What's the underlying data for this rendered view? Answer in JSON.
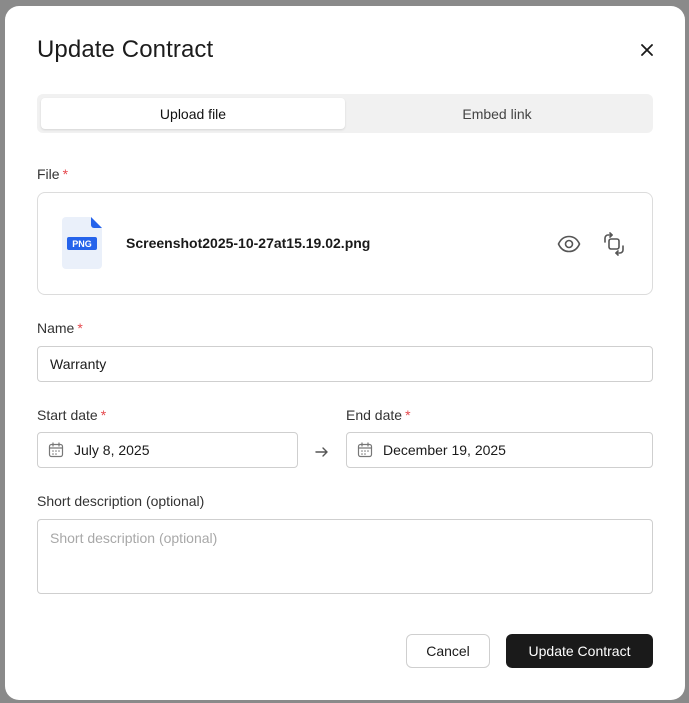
{
  "modal": {
    "title": "Update Contract"
  },
  "tabs": [
    {
      "label": "Upload file",
      "active": true
    },
    {
      "label": "Embed link",
      "active": false
    }
  ],
  "file": {
    "label": "File",
    "required_mark": "*",
    "badge": "PNG",
    "name": "Screenshot2025-10-27at15.19.02.png",
    "preview_icon": "eye-icon",
    "replace_icon": "replace-icon"
  },
  "name_field": {
    "label": "Name",
    "required_mark": "*",
    "value": "Warranty"
  },
  "start_date": {
    "label": "Start date",
    "required_mark": "*",
    "value": "July 8, 2025"
  },
  "end_date": {
    "label": "End date",
    "required_mark": "*",
    "value": "December 19, 2025"
  },
  "description": {
    "label": "Short description (optional)",
    "placeholder": "Short description (optional)",
    "value": ""
  },
  "actions": {
    "cancel_label": "Cancel",
    "submit_label": "Update Contract"
  },
  "colors": {
    "required": "#e5484d",
    "primary_button": "#1a1a1a",
    "file_badge": "#2563eb"
  }
}
